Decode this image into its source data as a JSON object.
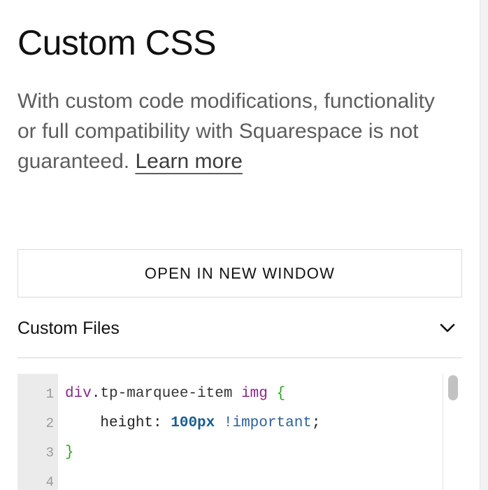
{
  "panel": {
    "title": "Custom CSS",
    "description": "With custom code modifications, functionality or full compatibility with Squarespace is not guaranteed.",
    "learn_more": "Learn more",
    "open_button": "OPEN IN NEW WINDOW",
    "custom_files": {
      "label": "Custom Files",
      "icon": "chevron-down-icon",
      "expanded": false
    }
  },
  "editor": {
    "lines": [
      {
        "number": "1",
        "tag": "div",
        "class_part": ".tp-marquee-item",
        "tag2": "img",
        "brace": "{"
      },
      {
        "number": "2",
        "property": "height:",
        "value": "100px",
        "important": "!important",
        "end": ";"
      },
      {
        "number": "3",
        "brace": "}"
      },
      {
        "number": "4"
      }
    ]
  },
  "colors": {
    "title_text": "#111111",
    "description_text": "#5d5d5d",
    "gutter_bg": "#ebebeb",
    "code_tag": "#8a2a85",
    "code_brace": "#2ea323",
    "code_number": "#1a5c8f",
    "code_important": "#2b5f9e"
  }
}
